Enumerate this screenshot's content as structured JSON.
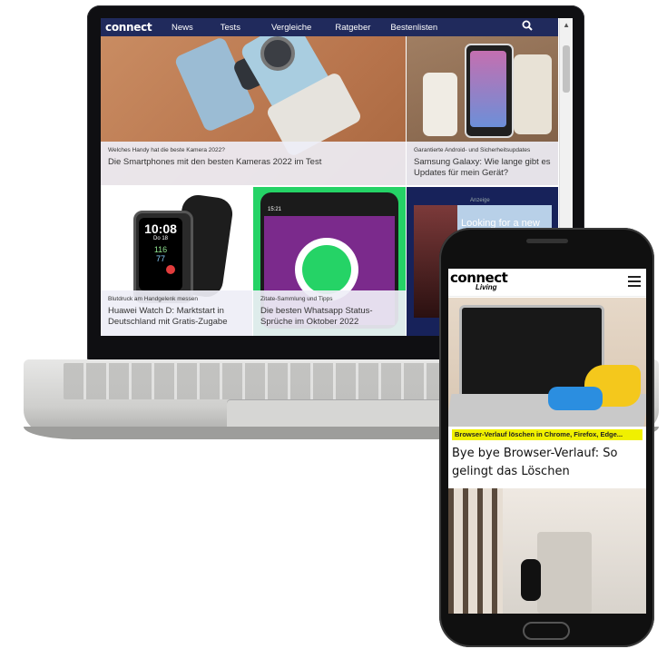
{
  "laptop": {
    "nav": {
      "logo": "connect",
      "items": [
        "News",
        "Tests",
        "Vergleiche",
        "Ratgeber",
        "Bestenlisten"
      ]
    },
    "articles": [
      {
        "kicker": "Welches Handy hat die beste Kamera 2022?",
        "title": "Die Smartphones mit den besten Kameras 2022 im Test"
      },
      {
        "kicker": "Garantierte Android- und Sicherheitsupdates",
        "title": "Samsung Galaxy: Wie lange gibt es Updates für mein Gerät?"
      },
      {
        "kicker": "Blutdruck am Handgelenk messen",
        "title": "Huawei Watch D: Marktstart in Deutschland mit Gratis-Zugabe"
      },
      {
        "kicker": "Zitate-Sammlung und Tipps",
        "title": "Die besten Whatsapp Status-Sprüche im Oktober 2022"
      }
    ],
    "watch_display": {
      "time": "10:08",
      "date": "Do 18",
      "reading_1": "116",
      "reading_2": "77"
    },
    "phone_status_time": "15:21",
    "ad": {
      "label": "Anzeige",
      "text": "Looking for a new"
    }
  },
  "phone": {
    "logo_main": "connect",
    "logo_sub": "Living",
    "article": {
      "kicker": "Browser-Verlauf löschen in Chrome, Firefox, Edge...",
      "title": "Bye bye Browser-Verlauf: So gelingt das Löschen"
    }
  },
  "colors": {
    "nav_bg": "#202a5c",
    "whatsapp_green": "#25d366",
    "whatsapp_purple": "#7b2a8c",
    "kicker_highlight": "#f0f000"
  },
  "icons": {
    "search": "search-icon",
    "menu": "hamburger-menu-icon",
    "scroll_up": "scroll-up-arrow-icon"
  }
}
